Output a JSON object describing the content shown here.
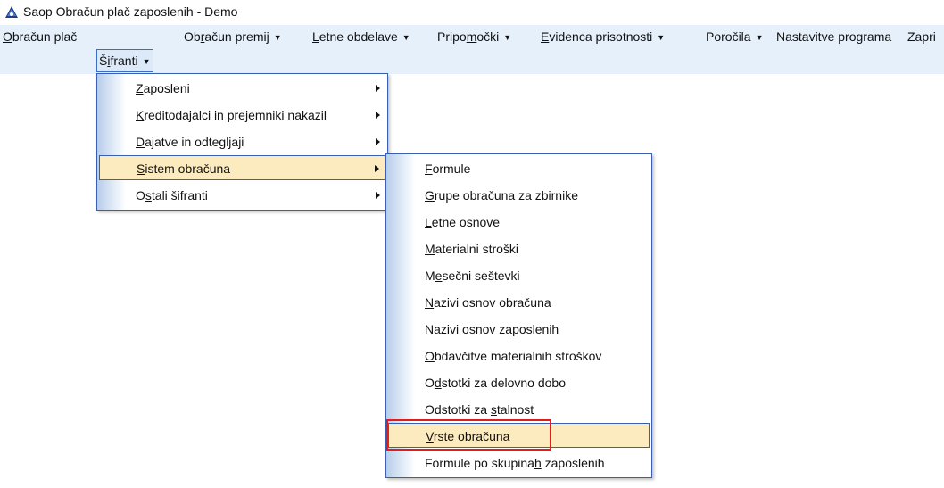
{
  "window": {
    "title": "Saop Obračun plač zaposlenih  - Demo",
    "icon": "app-logo-icon"
  },
  "menubar": {
    "items": [
      {
        "pre": "",
        "u": "O",
        "post": "bračun plač",
        "arrow": false
      },
      {
        "pre": "Š",
        "u": "i",
        "post": "franti",
        "arrow": true
      },
      {
        "pre": "Ob",
        "u": "r",
        "post": "ačun premij",
        "arrow": true
      },
      {
        "pre": "",
        "u": "L",
        "post": "etne obdelave",
        "arrow": true
      },
      {
        "pre": "Pripo",
        "u": "m",
        "post": "očki",
        "arrow": true
      },
      {
        "pre": "",
        "u": "E",
        "post": "videnca prisotnosti",
        "arrow": true
      },
      {
        "pre": "",
        "u": "",
        "post": "Poročila",
        "arrow": true
      },
      {
        "pre": "",
        "u": "",
        "post": "Nastavitve programa",
        "arrow": false
      },
      {
        "pre": "",
        "u": "",
        "post": "Zapri",
        "arrow": false
      }
    ]
  },
  "sifranti_menu": {
    "items": [
      {
        "pre": "",
        "u": "Z",
        "post": "aposleni"
      },
      {
        "pre": "",
        "u": "K",
        "post": "reditodajalci in prejemniki nakazil"
      },
      {
        "pre": "",
        "u": "D",
        "post": "ajatve in odtegljaji"
      },
      {
        "pre": "",
        "u": "S",
        "post": "istem obračuna"
      },
      {
        "pre": "O",
        "u": "s",
        "post": "tali šifranti"
      }
    ]
  },
  "sistem_obracuna_menu": {
    "items": [
      {
        "pre": "",
        "u": "F",
        "post": "ormule"
      },
      {
        "pre": "",
        "u": "G",
        "post": "rupe obračuna za zbirnike"
      },
      {
        "pre": "",
        "u": "L",
        "post": "etne osnove"
      },
      {
        "pre": "",
        "u": "M",
        "post": "aterialni stroški"
      },
      {
        "pre": "M",
        "u": "e",
        "post": "sečni seštevki"
      },
      {
        "pre": "",
        "u": "N",
        "post": "azivi osnov obračuna"
      },
      {
        "pre": "N",
        "u": "a",
        "post": "zivi osnov zaposlenih"
      },
      {
        "pre": "",
        "u": "O",
        "post": "bdavčitve materialnih stroškov"
      },
      {
        "pre": "O",
        "u": "d",
        "post": "stotki za delovno dobo"
      },
      {
        "pre": "Odstotki za ",
        "u": "s",
        "post": "talnost"
      },
      {
        "pre": "",
        "u": "V",
        "post": "rste obračuna"
      },
      {
        "pre": "Formule po skupina",
        "u": "h",
        "post": " zaposlenih"
      }
    ]
  }
}
